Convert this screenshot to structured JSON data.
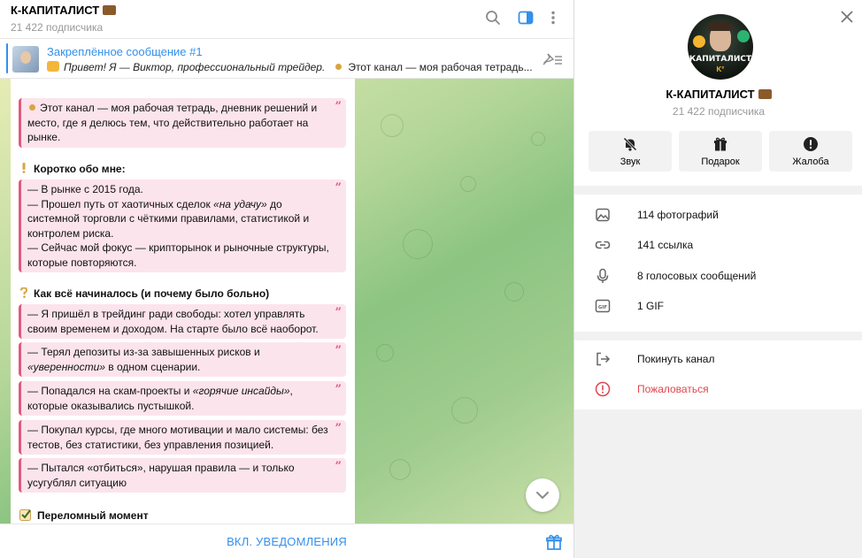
{
  "header": {
    "title": "К-КАПИТАЛИСТ",
    "subscribers": "21 422 подписчика",
    "icons": [
      "search-icon",
      "sidebar-toggle-icon",
      "more-vertical-icon"
    ]
  },
  "pinned": {
    "title": "Закреплённое сообщение #1",
    "text_italic": "Привет! Я — Виктор, профессиональный трейдер.",
    "text_rest": "Этот канал — моя рабочая тетрадь..."
  },
  "message": {
    "intro_quote": "Этот канал — моя рабочая тетрадь, дневник решений и место, где я делюсь тем, что действительно работает на рынке.",
    "about_heading": "Коротко обо мне:",
    "about_line1": "— В рынке с 2015 года.",
    "about_line2a": "— Прошел путь от хаотичных сделок ",
    "about_line2b": "«на удачу»",
    "about_line2c": " до системной торговли с чёткими правилами, статистикой и контролем риска.",
    "about_line3": "— Сейчас мой фокус — крипторынок и рыночные структуры, которые повторяются.",
    "start_heading": "Как всё начиналось (и почему было больно)",
    "start_q1": "— Я пришёл в трейдинг ради свободы: хотел управлять своим временем и доходом. На старте было всё наоборот.",
    "start_q2a": "— Терял депозиты из-за завышенных рисков и ",
    "start_q2b": "«уверенности»",
    "start_q2c": " в одном сценарии.",
    "start_q3a": "— Попадался на скам-проекты и ",
    "start_q3b": "«горячие инсайды»",
    "start_q3c": ", которые оказывались пустышкой.",
    "start_q4": "— Покупал курсы, где много мотивации и мало системы: без тестов, без статистики, без управления позицией.",
    "start_q5": "— Пытался «отбиться», нарушая правила — и только усугублял ситуацию",
    "turning_heading": "Переломный момент",
    "quote_mark": "”"
  },
  "bottom": {
    "notify_label": "ВКЛ. УВЕДОМЛЕНИЯ",
    "gift_icon": "gift-icon"
  },
  "panel": {
    "name": "К-КАПИТАЛИСТ",
    "subscribers": "21 422 подписчика",
    "avatar_text": "КАПИТАЛИСТ",
    "avatar_k": "K°",
    "actions": [
      {
        "label": "Звук",
        "icon": "bell-off-icon"
      },
      {
        "label": "Подарок",
        "icon": "gift-icon"
      },
      {
        "label": "Жалоба",
        "icon": "alert-icon"
      }
    ],
    "media": [
      {
        "label": "114 фотографий",
        "icon": "image-icon"
      },
      {
        "label": "141 ссылка",
        "icon": "link-icon"
      },
      {
        "label": "8 голосовых сообщений",
        "icon": "microphone-icon"
      },
      {
        "label": "1 GIF",
        "icon": "gif-icon"
      }
    ],
    "leave_label": "Покинуть канал",
    "report_label": "Пожаловаться"
  },
  "colors": {
    "accent": "#3390ec",
    "quote_border": "#e05a7e",
    "quote_bg": "#fce4ec",
    "danger": "#e0454f"
  }
}
